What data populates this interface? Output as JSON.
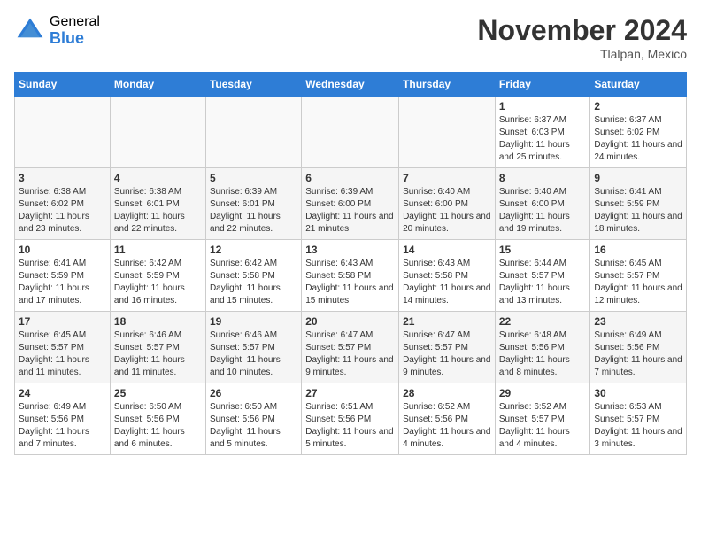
{
  "logo": {
    "general": "General",
    "blue": "Blue"
  },
  "header": {
    "month": "November 2024",
    "location": "Tlalpan, Mexico"
  },
  "weekdays": [
    "Sunday",
    "Monday",
    "Tuesday",
    "Wednesday",
    "Thursday",
    "Friday",
    "Saturday"
  ],
  "weeks": [
    [
      {
        "day": "",
        "info": ""
      },
      {
        "day": "",
        "info": ""
      },
      {
        "day": "",
        "info": ""
      },
      {
        "day": "",
        "info": ""
      },
      {
        "day": "",
        "info": ""
      },
      {
        "day": "1",
        "info": "Sunrise: 6:37 AM\nSunset: 6:03 PM\nDaylight: 11 hours and 25 minutes."
      },
      {
        "day": "2",
        "info": "Sunrise: 6:37 AM\nSunset: 6:02 PM\nDaylight: 11 hours and 24 minutes."
      }
    ],
    [
      {
        "day": "3",
        "info": "Sunrise: 6:38 AM\nSunset: 6:02 PM\nDaylight: 11 hours and 23 minutes."
      },
      {
        "day": "4",
        "info": "Sunrise: 6:38 AM\nSunset: 6:01 PM\nDaylight: 11 hours and 22 minutes."
      },
      {
        "day": "5",
        "info": "Sunrise: 6:39 AM\nSunset: 6:01 PM\nDaylight: 11 hours and 22 minutes."
      },
      {
        "day": "6",
        "info": "Sunrise: 6:39 AM\nSunset: 6:00 PM\nDaylight: 11 hours and 21 minutes."
      },
      {
        "day": "7",
        "info": "Sunrise: 6:40 AM\nSunset: 6:00 PM\nDaylight: 11 hours and 20 minutes."
      },
      {
        "day": "8",
        "info": "Sunrise: 6:40 AM\nSunset: 6:00 PM\nDaylight: 11 hours and 19 minutes."
      },
      {
        "day": "9",
        "info": "Sunrise: 6:41 AM\nSunset: 5:59 PM\nDaylight: 11 hours and 18 minutes."
      }
    ],
    [
      {
        "day": "10",
        "info": "Sunrise: 6:41 AM\nSunset: 5:59 PM\nDaylight: 11 hours and 17 minutes."
      },
      {
        "day": "11",
        "info": "Sunrise: 6:42 AM\nSunset: 5:59 PM\nDaylight: 11 hours and 16 minutes."
      },
      {
        "day": "12",
        "info": "Sunrise: 6:42 AM\nSunset: 5:58 PM\nDaylight: 11 hours and 15 minutes."
      },
      {
        "day": "13",
        "info": "Sunrise: 6:43 AM\nSunset: 5:58 PM\nDaylight: 11 hours and 15 minutes."
      },
      {
        "day": "14",
        "info": "Sunrise: 6:43 AM\nSunset: 5:58 PM\nDaylight: 11 hours and 14 minutes."
      },
      {
        "day": "15",
        "info": "Sunrise: 6:44 AM\nSunset: 5:57 PM\nDaylight: 11 hours and 13 minutes."
      },
      {
        "day": "16",
        "info": "Sunrise: 6:45 AM\nSunset: 5:57 PM\nDaylight: 11 hours and 12 minutes."
      }
    ],
    [
      {
        "day": "17",
        "info": "Sunrise: 6:45 AM\nSunset: 5:57 PM\nDaylight: 11 hours and 11 minutes."
      },
      {
        "day": "18",
        "info": "Sunrise: 6:46 AM\nSunset: 5:57 PM\nDaylight: 11 hours and 11 minutes."
      },
      {
        "day": "19",
        "info": "Sunrise: 6:46 AM\nSunset: 5:57 PM\nDaylight: 11 hours and 10 minutes."
      },
      {
        "day": "20",
        "info": "Sunrise: 6:47 AM\nSunset: 5:57 PM\nDaylight: 11 hours and 9 minutes."
      },
      {
        "day": "21",
        "info": "Sunrise: 6:47 AM\nSunset: 5:57 PM\nDaylight: 11 hours and 9 minutes."
      },
      {
        "day": "22",
        "info": "Sunrise: 6:48 AM\nSunset: 5:56 PM\nDaylight: 11 hours and 8 minutes."
      },
      {
        "day": "23",
        "info": "Sunrise: 6:49 AM\nSunset: 5:56 PM\nDaylight: 11 hours and 7 minutes."
      }
    ],
    [
      {
        "day": "24",
        "info": "Sunrise: 6:49 AM\nSunset: 5:56 PM\nDaylight: 11 hours and 7 minutes."
      },
      {
        "day": "25",
        "info": "Sunrise: 6:50 AM\nSunset: 5:56 PM\nDaylight: 11 hours and 6 minutes."
      },
      {
        "day": "26",
        "info": "Sunrise: 6:50 AM\nSunset: 5:56 PM\nDaylight: 11 hours and 5 minutes."
      },
      {
        "day": "27",
        "info": "Sunrise: 6:51 AM\nSunset: 5:56 PM\nDaylight: 11 hours and 5 minutes."
      },
      {
        "day": "28",
        "info": "Sunrise: 6:52 AM\nSunset: 5:56 PM\nDaylight: 11 hours and 4 minutes."
      },
      {
        "day": "29",
        "info": "Sunrise: 6:52 AM\nSunset: 5:57 PM\nDaylight: 11 hours and 4 minutes."
      },
      {
        "day": "30",
        "info": "Sunrise: 6:53 AM\nSunset: 5:57 PM\nDaylight: 11 hours and 3 minutes."
      }
    ]
  ]
}
